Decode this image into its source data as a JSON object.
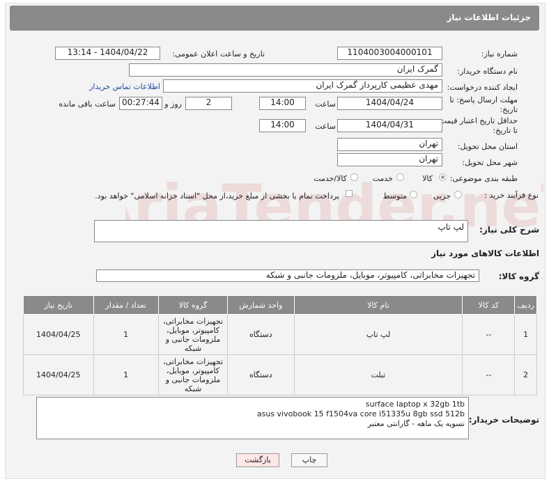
{
  "header": {
    "title": "جزئیات اطلاعات نیاز"
  },
  "form": {
    "need_number_label": "شماره نیاز:",
    "need_number": "1104003004000101",
    "announce_label": "تاریخ و ساعت اعلان عمومی:",
    "announce_value": "1404/04/22 - 13:14",
    "buyer_label": "نام دستگاه خریدار:",
    "buyer_value": "گمرک ایران",
    "creator_label": "ایجاد کننده درخواست:",
    "creator_value": "مهدی عظیمی کارپرداز گمرک ایران",
    "contact_link": "اطلاعات تماس خریدار",
    "deadline_label_1": "مهلت ارسال پاسخ: تا",
    "deadline_label_2": "تاریخ:",
    "deadline_date": "1404/04/24",
    "time_label": "ساعت",
    "deadline_time": "14:00",
    "days_value": "2",
    "days_label": "روز و",
    "remaining_time": "00:27:44",
    "remaining_label": "ساعت باقی مانده",
    "price_label_1": "حداقل تاریخ اعتبار قیمت:",
    "price_label_2": "تا تاریخ:",
    "price_date": "1404/04/31",
    "price_time": "14:00",
    "province_label": "استان محل تحویل:",
    "province_value": "تهران",
    "city_label": "شهر محل تحویل:",
    "city_value": "تهران",
    "category_label": "طبقه بندی موضوعی:",
    "cat_goods": "کالا",
    "cat_service": "خدمت",
    "cat_both": "کالا/خدمت",
    "process_label": "نوع فرآیند خرید :",
    "proc_partial": "جزیی",
    "proc_medium": "متوسط",
    "payment_note": "پرداخت تمام یا بخشی از مبلغ خرید،از محل \"اسناد خزانه اسلامی\" خواهد بود."
  },
  "desc": {
    "label": "شرح کلی نیاز:",
    "value": "لپ تاپ"
  },
  "goods_section": {
    "title": "اطلاعات کالاهای مورد نیاز",
    "group_label": "گروه کالا:",
    "group_value": "تجهیزات مخابراتی، کامپیوتر، موبایل، ملزومات جانبی و شبکه"
  },
  "table": {
    "headers": [
      "ردیف",
      "کد کالا",
      "نام کالا",
      "واحد شمارش",
      "گروه کالا",
      "تعداد / مقدار",
      "تاریخ نیاز"
    ],
    "rows": [
      [
        "1",
        "--",
        "لپ تاپ",
        "دستگاه",
        "تجهیزات مخابراتی، کامپیوتر، موبایل، ملزومات جانبی و شبکه",
        "1",
        "1404/04/25"
      ],
      [
        "2",
        "--",
        "تبلت",
        "دستگاه",
        "تجهیزات مخابراتی، کامپیوتر، موبایل، ملزومات جانبی و شبکه",
        "1",
        "1404/04/25"
      ]
    ]
  },
  "buyer_notes": {
    "label": "توضیحات خریدار:",
    "line1": "surface laptop x 32gb 1tb",
    "line2": "asus vivobook 15 f1504va core i51335u 8gb ssd 512b",
    "line3": "تسویه یک ماهه - گارانتی معتبر"
  },
  "buttons": {
    "print": "چاپ",
    "back": "بازگشت"
  },
  "watermark": "AriaTender.neT"
}
